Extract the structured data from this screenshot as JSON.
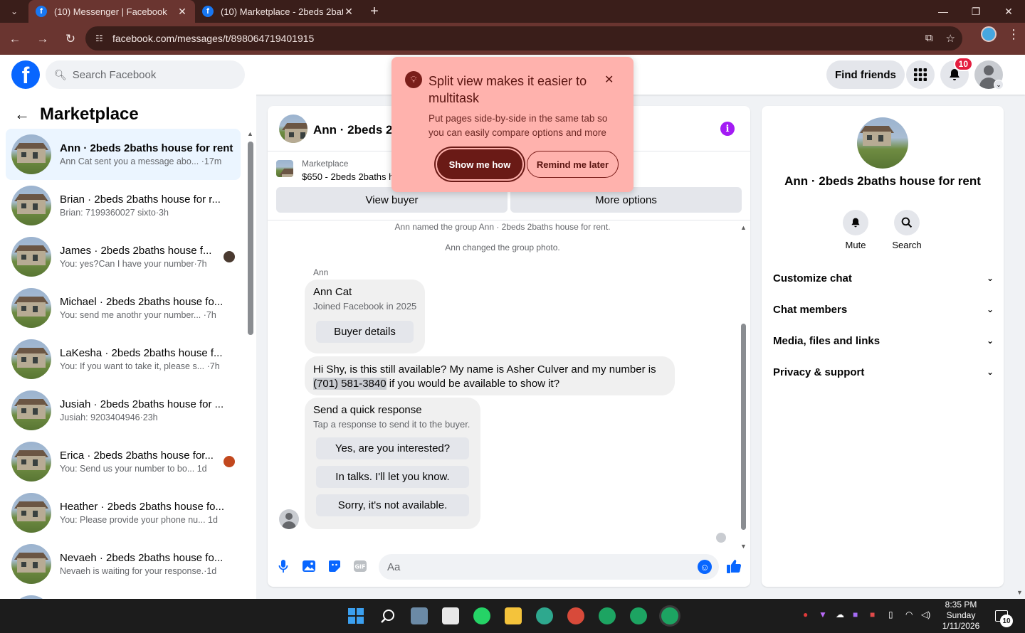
{
  "browser": {
    "tabs": [
      {
        "title": "(10) Messenger | Facebook",
        "active": true
      },
      {
        "title": "(10) Marketplace - 2beds 2bath",
        "active": false
      }
    ],
    "url": "facebook.com/messages/t/898064719401915"
  },
  "header": {
    "search_placeholder": "Search Facebook",
    "find_friends": "Find friends",
    "notification_count": "10"
  },
  "sidebar": {
    "title": "Marketplace",
    "conversations": [
      {
        "name": "Ann · 2beds 2baths house for rent",
        "preview": "Ann Cat sent you a message abo...",
        "time": "·17m",
        "active": true
      },
      {
        "name": "Brian · 2beds 2baths house for r...",
        "preview": "Brian: 7199360027 sixto",
        "time": "·3h"
      },
      {
        "name": "James · 2beds 2baths house f...",
        "preview": "You: yes?Can I have your number",
        "time": "·7h"
      },
      {
        "name": "Michael · 2beds 2baths house fo...",
        "preview": "You: send me anothr your number...",
        "time": "·7h"
      },
      {
        "name": "LaKesha · 2beds 2baths house f...",
        "preview": "You: If you want to take it, please s...",
        "time": "·7h"
      },
      {
        "name": "Jusiah · 2beds 2baths house for ...",
        "preview": "Jusiah: 9203404946",
        "time": "·23h"
      },
      {
        "name": "Erica · 2beds 2baths house for...",
        "preview": "You: Send us your number to bo...",
        "time": "1d"
      },
      {
        "name": "Heather · 2beds 2baths house fo...",
        "preview": "You: Please provide your phone nu...",
        "time": "1d"
      },
      {
        "name": "Nevaeh · 2beds 2baths house fo...",
        "preview": "Nevaeh is waiting for your response.",
        "time": "·1d"
      }
    ]
  },
  "chat": {
    "title": "Ann · 2beds 2b",
    "marketplace_label": "Marketplace",
    "listing": "$650 - 2beds 2baths h",
    "view_buyer": "View buyer",
    "more_options": "More options",
    "system_messages": [
      "Ann named the group Ann · 2beds 2baths house for rent.",
      "Ann changed the group photo."
    ],
    "sender": "Ann",
    "profile_card": {
      "name": "Ann Cat",
      "joined": "Joined Facebook in 2025",
      "button": "Buyer details"
    },
    "message_before": "Hi Shy, is this still available? My name is Asher Culver and my number is ",
    "message_phone": "(701) 581-3840",
    "message_after": " if you would be available to show it?",
    "quick_response": {
      "title": "Send a quick response",
      "subtitle": "Tap a response to send it to the buyer.",
      "options": [
        "Yes, are you interested?",
        "In talks. I'll let you know.",
        "Sorry, it's not available."
      ]
    },
    "composer_placeholder": "Aa"
  },
  "popup": {
    "title": "Split view makes it easier to multitask",
    "description": "Put pages side-by-side in the same tab so you can easily compare options and more",
    "primary": "Show me how",
    "secondary": "Remind me later"
  },
  "details": {
    "name": "Ann · 2beds 2baths house for rent",
    "mute": "Mute",
    "search": "Search",
    "sections": [
      "Customize chat",
      "Chat members",
      "Media, files and links",
      "Privacy & support"
    ]
  },
  "taskbar": {
    "time": "8:35 PM",
    "day": "Sunday",
    "date": "1/11/2026",
    "notification_count": "10"
  },
  "colors": {
    "fb_blue": "#0866ff",
    "browser_frame": "#3a1e1a",
    "popup_bg": "#ffb2ad",
    "info_purple": "#a31bf4"
  }
}
